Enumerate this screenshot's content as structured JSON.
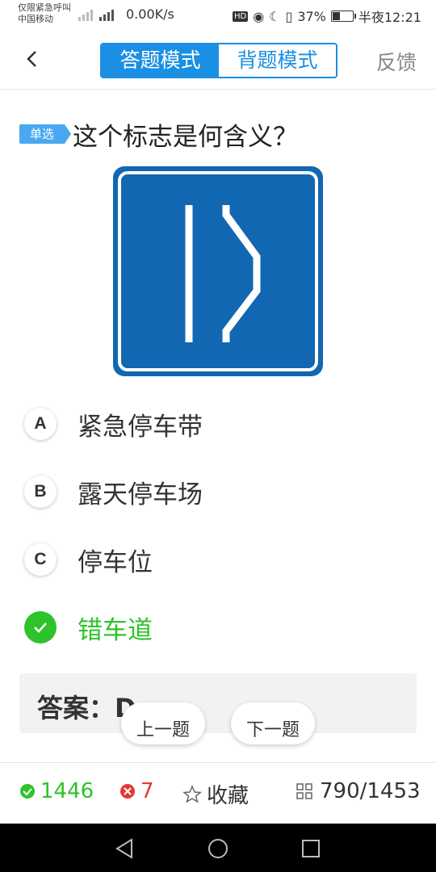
{
  "status_bar": {
    "carrier_line1": "仅限紧急呼叫",
    "carrier_line2": "中国移动",
    "speed": "0.00K/s",
    "hd": "HD",
    "battery": "37%",
    "time": "半夜12:21"
  },
  "header": {
    "tab_answer": "答题模式",
    "tab_memorize": "背题模式",
    "feedback": "反馈"
  },
  "question": {
    "type_badge": "单选",
    "text": "这个标志是何含义？"
  },
  "options": [
    {
      "letter": "A",
      "label": "紧急停车带"
    },
    {
      "letter": "B",
      "label": "露天停车场"
    },
    {
      "letter": "C",
      "label": "停车位"
    },
    {
      "letter": "D",
      "label": "错车道"
    }
  ],
  "answer": {
    "text": "答案：D"
  },
  "nav": {
    "prev": "上一题",
    "next": "下一题"
  },
  "bottom": {
    "correct_count": "1446",
    "wrong_count": "7",
    "favorite": "收藏",
    "progress": "790/1453"
  },
  "colors": {
    "accent": "#1a8fe3",
    "correct": "#2ec32a",
    "wrong": "#e53935",
    "sign_blue": "#1167b1"
  }
}
